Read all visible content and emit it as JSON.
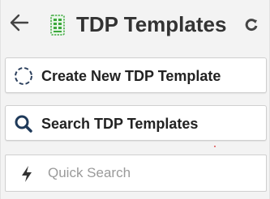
{
  "header": {
    "back_icon": "arrow-left-icon",
    "app_icon": "grid-document-icon",
    "title": "TDP Templates",
    "refresh_icon": "refresh-icon"
  },
  "actions": {
    "create": {
      "icon": "dashed-circle-icon",
      "label": "Create New TDP Template"
    },
    "search": {
      "icon": "magnifier-icon",
      "label": "Search TDP Templates"
    }
  },
  "quick_search": {
    "icon": "lightning-bolt-icon",
    "placeholder": "Quick Search",
    "value": ""
  },
  "colors": {
    "app_icon_green": "#3ca83c",
    "search_icon_navy": "#1f3a5a",
    "text_dark": "#333333",
    "placeholder_gray": "#9a9a9a"
  }
}
